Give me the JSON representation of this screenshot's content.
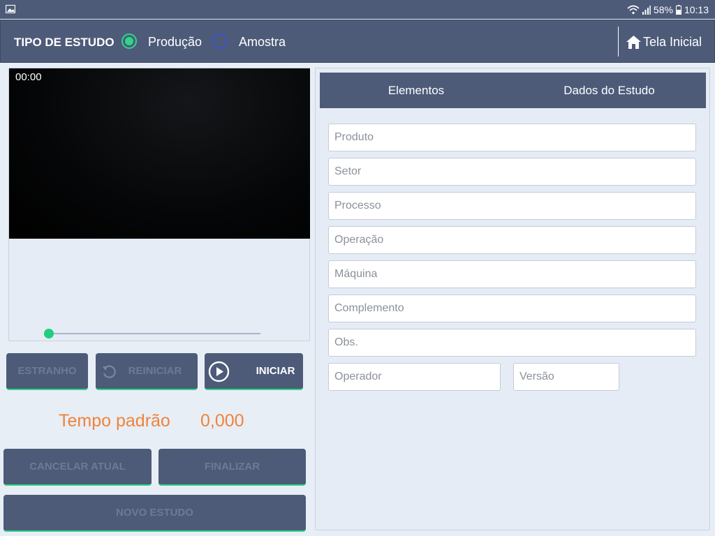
{
  "status_bar": {
    "battery": "58%",
    "time": "10:13"
  },
  "header": {
    "study_type_label": "TIPO DE ESTUDO",
    "options": [
      {
        "label": "Produção",
        "selected": true
      },
      {
        "label": "Amostra",
        "selected": false
      }
    ],
    "home_label": "Tela Inicial"
  },
  "video": {
    "timecode": "00:00",
    "seek_fraction": 0
  },
  "buttons": {
    "estranho": "ESTRANHO",
    "reiniciar": "REINICIAR",
    "iniciar": "INICIAR",
    "cancelar": "CANCELAR ATUAL",
    "finalizar": "FINALIZAR",
    "novo": "NOVO ESTUDO"
  },
  "tempo": {
    "label": "Tempo padrão",
    "value": "0,000"
  },
  "tabs": [
    "Elementos",
    "Dados do Estudo"
  ],
  "form": {
    "produto": "Produto",
    "setor": "Setor",
    "processo": "Processo",
    "operacao": "Operação",
    "maquina": "Máquina",
    "complemento": "Complemento",
    "obs": "Obs.",
    "operador": "Operador",
    "versao": "Versão"
  },
  "colors": {
    "bar": "#4d5b79",
    "accent_green": "#2ed68a",
    "tempo_orange": "#f0833a",
    "background": "#e8eef6"
  }
}
